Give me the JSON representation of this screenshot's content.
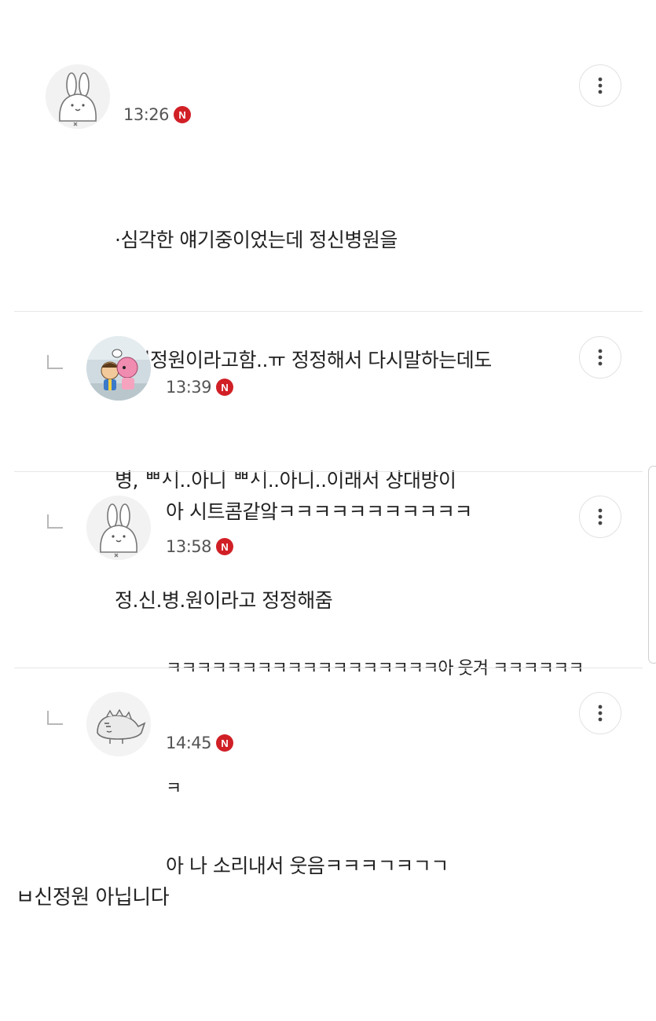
{
  "comments": [
    {
      "time": "13:26",
      "badge": "N",
      "avatar": "bunny-avatar-icon",
      "lines": [
        "·심각한 얘기중이었는데 정신병원을",
        "ᄈᄼᅵ정원이라고함..ㅠ 정정해서 다시말하는데도",
        "병, ᄈᄼᅵ..아니 ᄈᄼᅵ..아니..이래서 상대방이",
        "정.신.병.원이라고 정정해줌"
      ]
    },
    {
      "time": "13:39",
      "badge": "N",
      "avatar": "game-characters-avatar-icon",
      "lines": [
        "아 시트콤같앜ㅋㅋㅋㅋㅋㅋㅋㅋㅋㅋㅋ"
      ]
    },
    {
      "time": "13:58",
      "badge": "N",
      "avatar": "bunny-avatar-icon",
      "lines": [
        "ㅋㅋㅋㅋㅋㅋㅋㅋㅋㅋㅋㅋㅋㅋㅋㅋㅋㅋ아 웃겨 ㅋㅋㅋㅋㅋㅋ",
        "ㅋ"
      ]
    },
    {
      "time": "14:45",
      "badge": "N",
      "avatar": "dinosaur-avatar-icon",
      "lines": [
        "아 나 소리내서 웃음ㅋㅋㅋㄱㅋㄱㄱ"
      ]
    }
  ],
  "footer_note": "ㅂ신정원 아닙니다",
  "colors": {
    "badge": "#d11f26",
    "divider": "#e6e6e6",
    "text": "#222222",
    "time": "#555555"
  }
}
